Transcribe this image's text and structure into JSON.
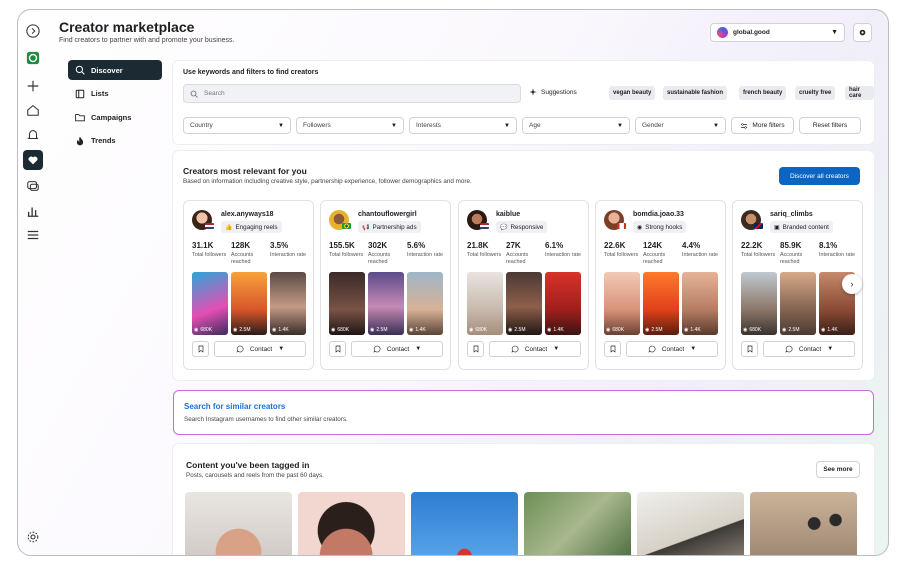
{
  "header": {
    "title": "Creator marketplace",
    "subtitle": "Find creators to partner with and promote your business.",
    "account_name": "global.good"
  },
  "rail": {
    "icons": [
      "expand-icon",
      "brand-logo-icon",
      "plus-icon",
      "home-icon",
      "notifications-icon",
      "creator-marketplace-icon",
      "messages-icon",
      "insights-icon",
      "menu-icon",
      "settings-icon"
    ]
  },
  "nav": {
    "items": [
      {
        "label": "Discover",
        "icon": "search-icon",
        "active": true
      },
      {
        "label": "Lists",
        "icon": "lists-icon",
        "active": false
      },
      {
        "label": "Campaigns",
        "icon": "folder-icon",
        "active": false
      },
      {
        "label": "Trends",
        "icon": "flame-icon",
        "active": false
      }
    ]
  },
  "search": {
    "heading": "Use keywords and filters to find creators",
    "placeholder": "Search",
    "suggestions_label": "Suggestions",
    "chips": [
      "vegan beauty",
      "sustainable fashion",
      "french beauty",
      "cruelty free",
      "hair care"
    ],
    "filters": [
      "Country",
      "Followers",
      "Interests",
      "Age",
      "Gender"
    ],
    "more_filters": "More filters",
    "reset_filters": "Reset filters"
  },
  "creators": {
    "title": "Creators most relevant for you",
    "subtitle": "Based on information including creative style, partnership experience, follower demographics and more.",
    "discover_all": "Discover all creators",
    "stat_labels": {
      "followers": "Total followers",
      "reached": "Accounts reached",
      "interaction": "Interaction rate"
    },
    "contact_label": "Contact",
    "items": [
      {
        "username": "alex.anyways18",
        "tag": "Engaging reels",
        "followers": "31.1K",
        "reached": "128K",
        "interaction": "3.5%",
        "views": [
          "680K",
          "2.5M",
          "1.4K"
        ]
      },
      {
        "username": "chantouflowergirl",
        "tag": "Partnership ads",
        "followers": "155.5K",
        "reached": "302K",
        "interaction": "5.6%",
        "views": [
          "680K",
          "2.5M",
          "1.4K"
        ]
      },
      {
        "username": "kaiblue",
        "tag": "Responsive",
        "followers": "21.8K",
        "reached": "27K",
        "interaction": "6.1%",
        "views": [
          "680K",
          "2.5M",
          "1.4K"
        ]
      },
      {
        "username": "bomdia.joao.33",
        "tag": "Strong hooks",
        "followers": "22.6K",
        "reached": "124K",
        "interaction": "4.4%",
        "views": [
          "680K",
          "2.5M",
          "1.4K"
        ]
      },
      {
        "username": "sariq_climbs",
        "tag": "Branded content",
        "followers": "22.2K",
        "reached": "85.9K",
        "interaction": "8.1%",
        "views": [
          "680K",
          "2.5M",
          "1.4K"
        ]
      }
    ]
  },
  "similar": {
    "title": "Search for similar creators",
    "subtitle": "Search Instagram usernames to find other similar creators."
  },
  "tagged": {
    "title": "Content you've been tagged in",
    "subtitle": "Posts, carousels and reels from the past 60 days.",
    "see_more": "See more"
  },
  "colors": {
    "nav_active": "#1c2b33",
    "primary": "#0a66c2",
    "link": "#1d6fd8",
    "similar_border": "#c86dd7"
  }
}
